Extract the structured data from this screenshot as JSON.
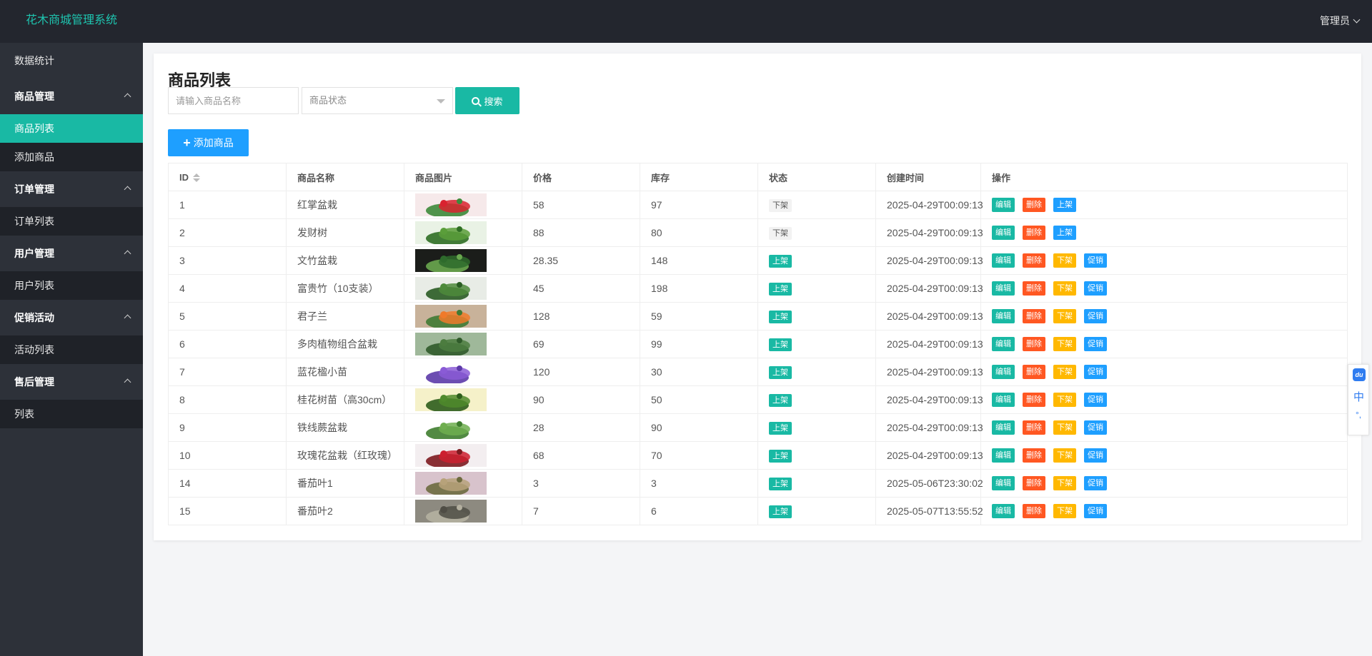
{
  "header": {
    "title": "花木商城管理系统",
    "user": "管理员"
  },
  "sidebar": {
    "dashboard": "数据统计",
    "groups": [
      {
        "label": "商品管理",
        "items": [
          "商品列表",
          "添加商品"
        ]
      },
      {
        "label": "订单管理",
        "items": [
          "订单列表"
        ]
      },
      {
        "label": "用户管理",
        "items": [
          "用户列表"
        ]
      },
      {
        "label": "促销活动",
        "items": [
          "活动列表"
        ]
      },
      {
        "label": "售后管理",
        "items": [
          "列表"
        ]
      }
    ],
    "active_item": "商品列表"
  },
  "page": {
    "title": "商品列表",
    "search_placeholder": "请输入商品名称",
    "status_placeholder": "商品状态",
    "search_button": "搜索",
    "add_button": "添加商品"
  },
  "table": {
    "headers": [
      "ID",
      "商品名称",
      "商品图片",
      "价格",
      "库存",
      "状态",
      "创建时间",
      "操作"
    ],
    "action_labels": {
      "edit": "编辑",
      "delete": "删除",
      "on_shelf": "上架",
      "off_shelf": "下架",
      "promote": "促销"
    },
    "rows": [
      {
        "id": "1",
        "name": "红掌盆栽",
        "price": "58",
        "stock": "97",
        "status": "下架",
        "created": "2025-04-29T00:09:13"
      },
      {
        "id": "2",
        "name": "发财树",
        "price": "88",
        "stock": "80",
        "status": "下架",
        "created": "2025-04-29T00:09:13"
      },
      {
        "id": "3",
        "name": "文竹盆栽",
        "price": "28.35",
        "stock": "148",
        "status": "上架",
        "created": "2025-04-29T00:09:13"
      },
      {
        "id": "4",
        "name": "富贵竹（10支装）",
        "price": "45",
        "stock": "198",
        "status": "上架",
        "created": "2025-04-29T00:09:13"
      },
      {
        "id": "5",
        "name": "君子兰",
        "price": "128",
        "stock": "59",
        "status": "上架",
        "created": "2025-04-29T00:09:13"
      },
      {
        "id": "6",
        "name": "多肉植物组合盆栽",
        "price": "69",
        "stock": "99",
        "status": "上架",
        "created": "2025-04-29T00:09:13"
      },
      {
        "id": "7",
        "name": "蓝花楹小苗",
        "price": "120",
        "stock": "30",
        "status": "上架",
        "created": "2025-04-29T00:09:13"
      },
      {
        "id": "8",
        "name": "桂花树苗（高30cm）",
        "price": "90",
        "stock": "50",
        "status": "上架",
        "created": "2025-04-29T00:09:13"
      },
      {
        "id": "9",
        "name": "铁线蕨盆栽",
        "price": "28",
        "stock": "90",
        "status": "上架",
        "created": "2025-04-29T00:09:13"
      },
      {
        "id": "10",
        "name": "玫瑰花盆栽（红玫瑰）",
        "price": "68",
        "stock": "70",
        "status": "上架",
        "created": "2025-04-29T00:09:13"
      },
      {
        "id": "14",
        "name": "番茄叶1",
        "price": "3",
        "stock": "3",
        "status": "上架",
        "created": "2025-05-06T23:30:02"
      },
      {
        "id": "15",
        "name": "番茄叶2",
        "price": "7",
        "stock": "6",
        "status": "上架",
        "created": "2025-05-07T13:55:52"
      }
    ]
  },
  "float_widget": {
    "zh": "中"
  },
  "colors": {
    "accent": "#19b9a4",
    "blue": "#1e9fff",
    "red": "#ff5722",
    "yellow": "#ffb800",
    "header_bg": "#23262e",
    "sidebar_bg": "#2d3139"
  }
}
